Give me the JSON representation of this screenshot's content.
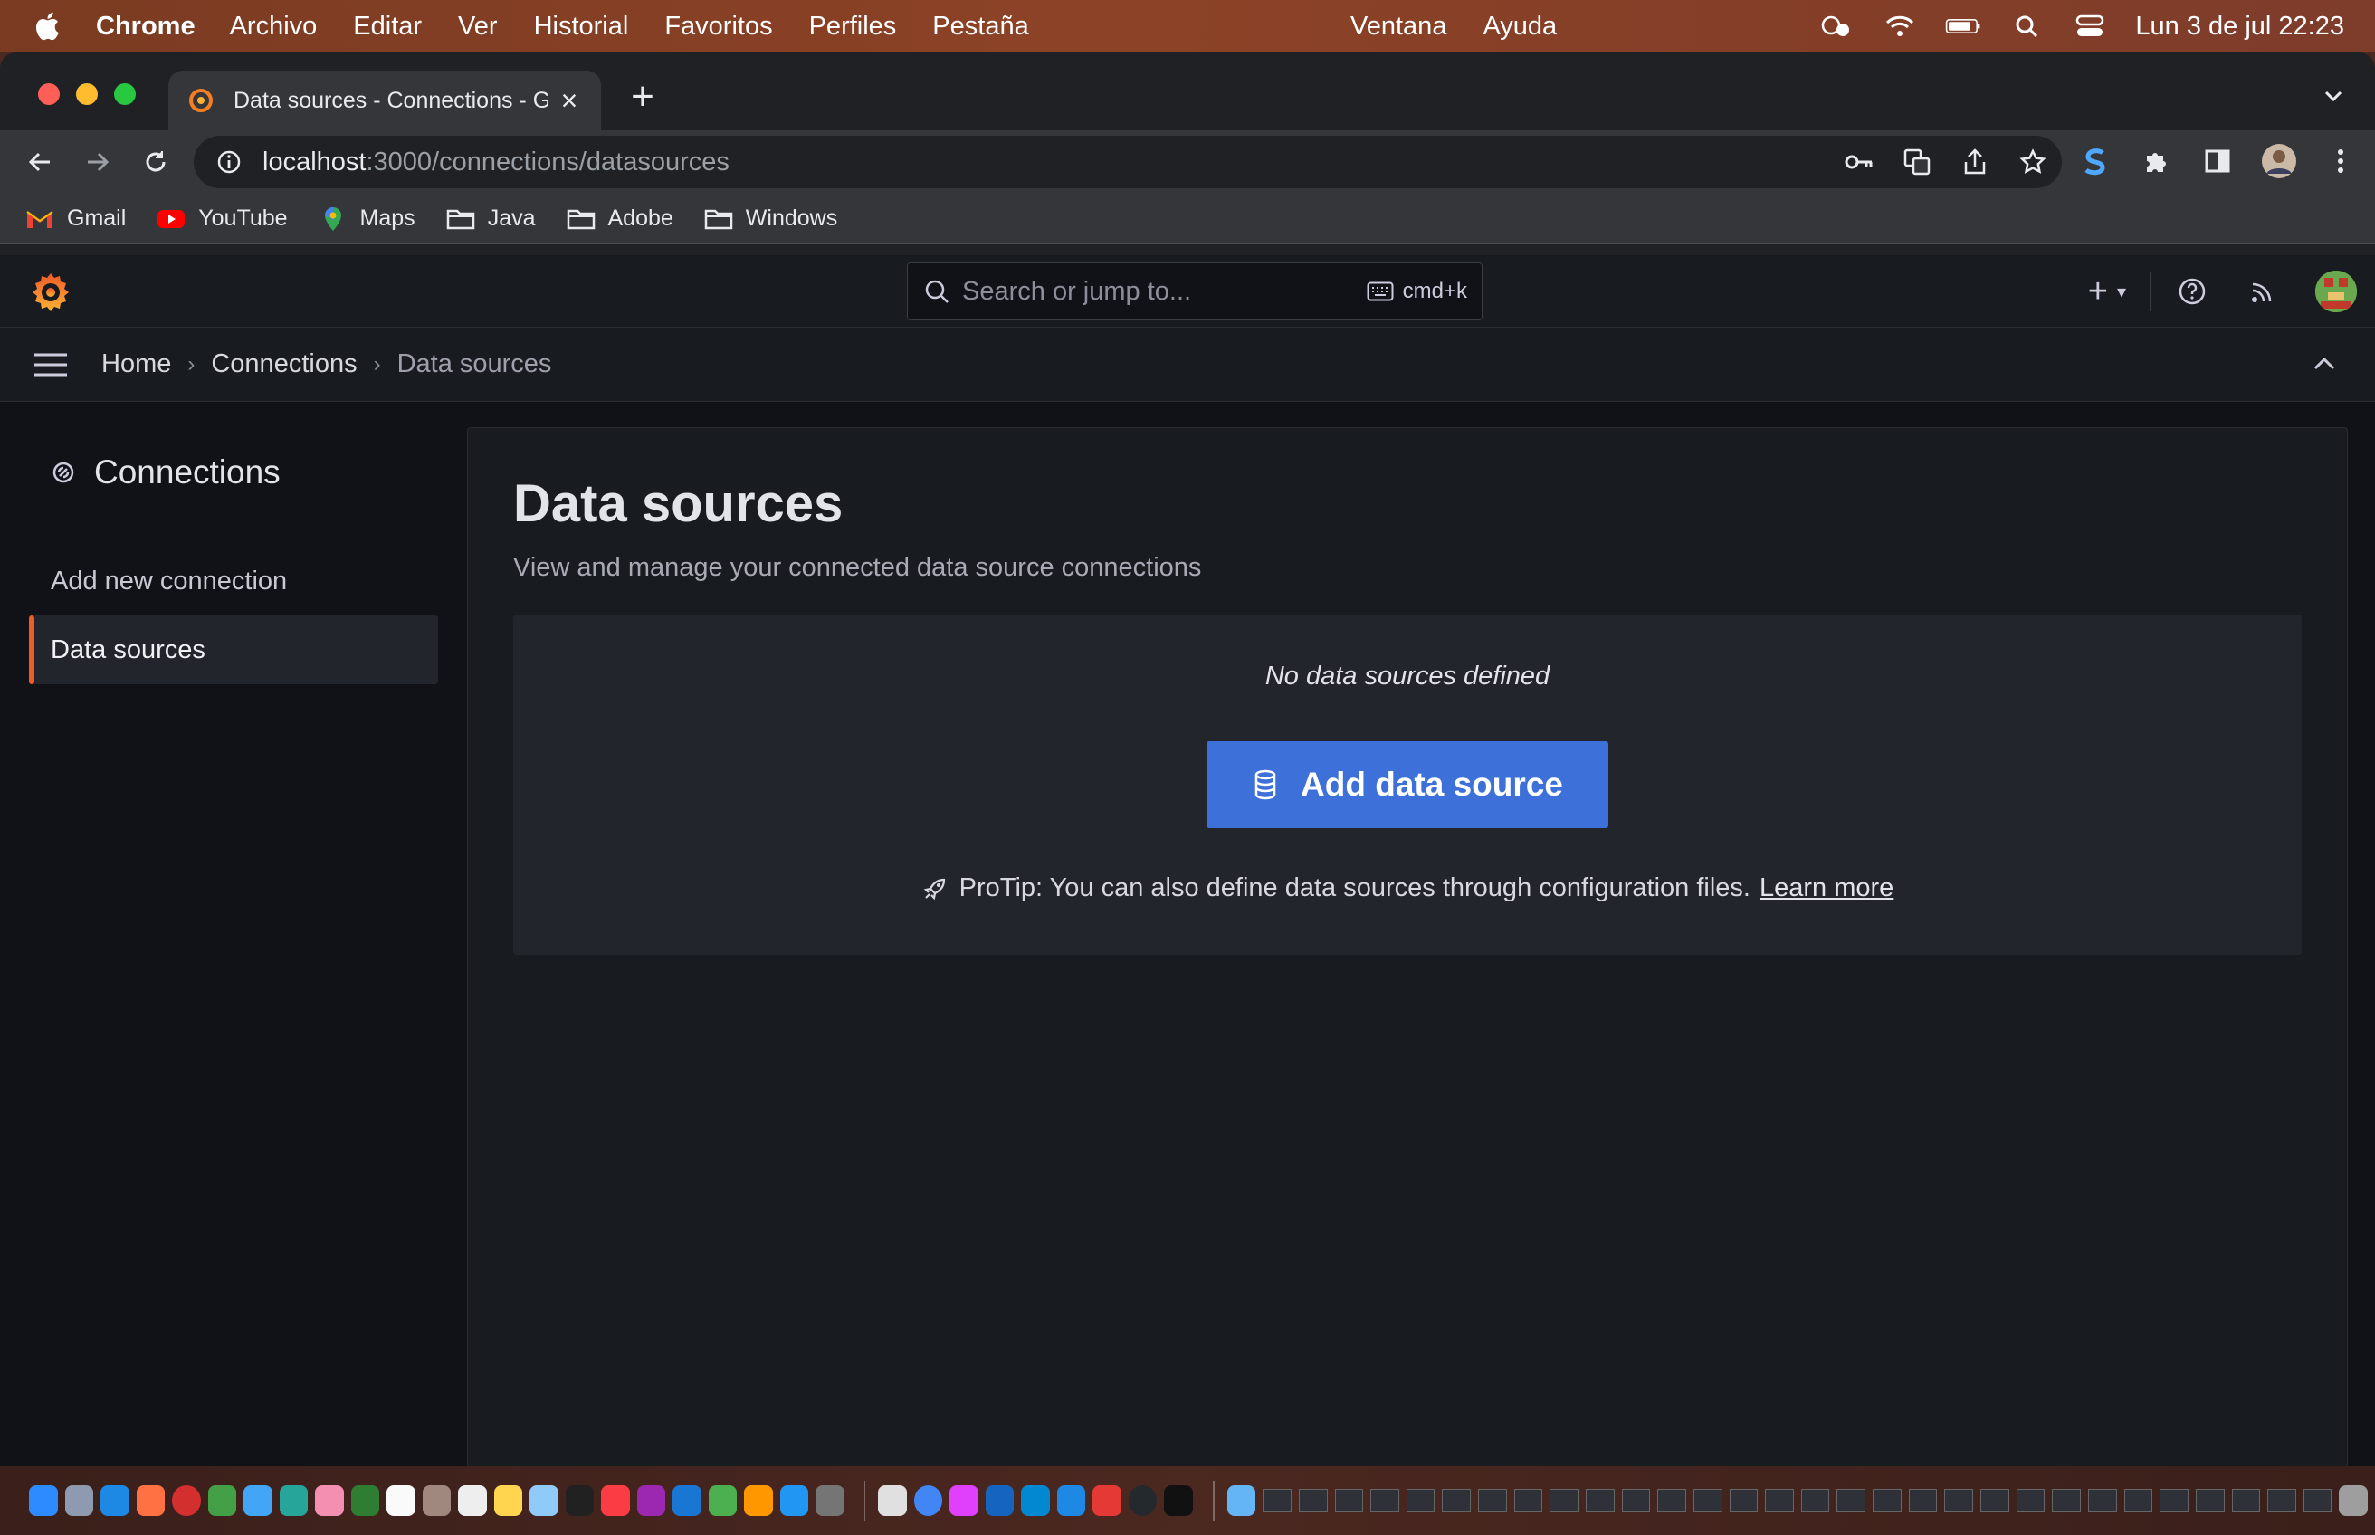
{
  "menubar": {
    "app_name": "Chrome",
    "menus": [
      "Archivo",
      "Editar",
      "Ver",
      "Historial",
      "Favoritos",
      "Perfiles",
      "Pestaña"
    ],
    "menus_right": [
      "Ventana",
      "Ayuda"
    ],
    "clock": "Lun 3 de jul  22:23"
  },
  "browser": {
    "tab_title": "Data sources - Connections - G",
    "url_host": "localhost",
    "url_path": ":3000/connections/datasources",
    "bookmarks": [
      {
        "label": "Gmail",
        "icon": "gmail-icon"
      },
      {
        "label": "YouTube",
        "icon": "youtube-icon"
      },
      {
        "label": "Maps",
        "icon": "maps-icon"
      },
      {
        "label": "Java",
        "icon": "folder-icon"
      },
      {
        "label": "Adobe",
        "icon": "folder-icon"
      },
      {
        "label": "Windows",
        "icon": "folder-icon"
      }
    ]
  },
  "grafana": {
    "search_placeholder": "Search or jump to...",
    "search_shortcut": "cmd+k",
    "breadcrumb": [
      "Home",
      "Connections",
      "Data sources"
    ],
    "sidebar": {
      "title": "Connections",
      "items": [
        {
          "label": "Add new connection",
          "active": false
        },
        {
          "label": "Data sources",
          "active": true
        }
      ]
    },
    "page": {
      "title": "Data sources",
      "subtitle": "View and manage your connected data source connections",
      "empty_message": "No data sources defined",
      "add_button": "Add data source",
      "protip": "ProTip: You can also define data sources through configuration files.",
      "learn_more": "Learn more"
    }
  },
  "colors": {
    "accent": "#3d71d9",
    "active_marker": "#f05a28",
    "background": "#111217",
    "panel": "#181b1f"
  }
}
